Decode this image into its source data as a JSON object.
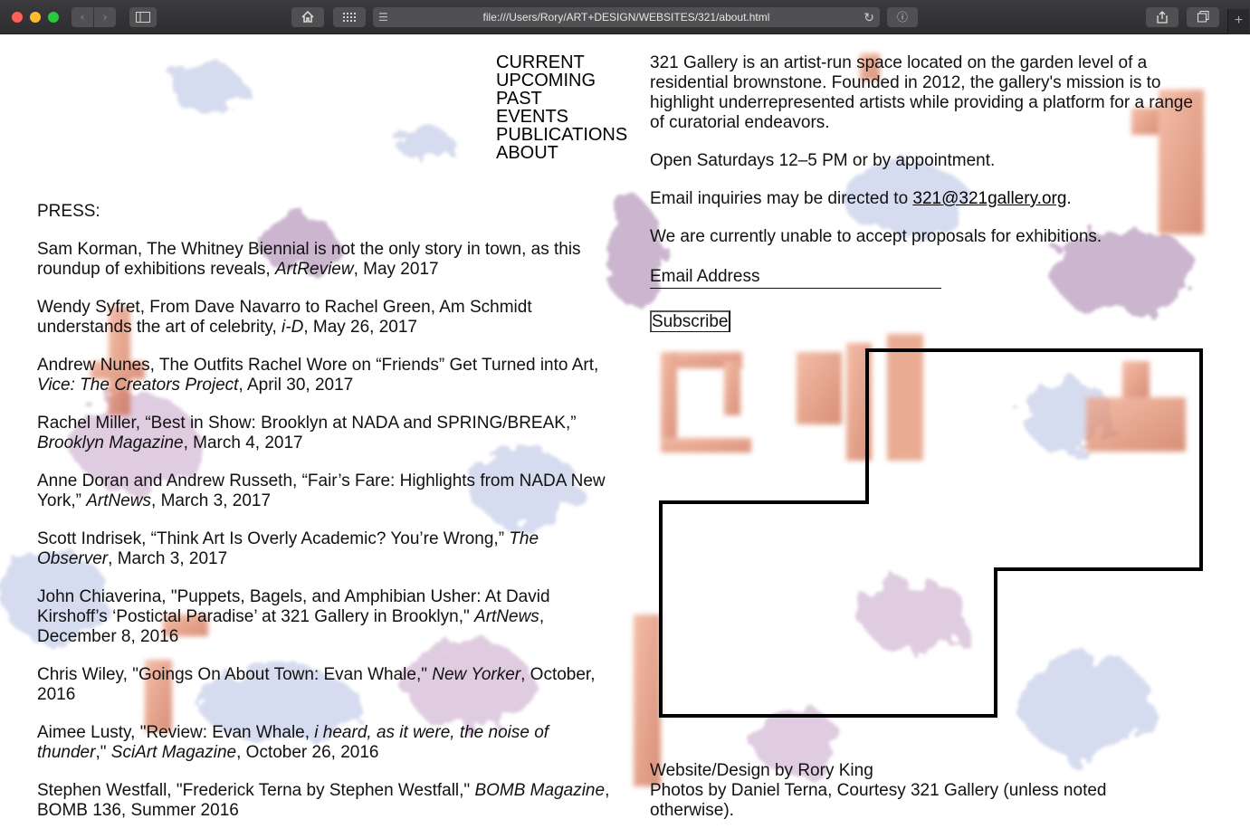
{
  "browser": {
    "url": "file:///Users/Rory/ART+DESIGN/WEBSITES/321/about.html"
  },
  "nav": {
    "items": [
      "CURRENT",
      "UPCOMING",
      "PAST",
      "EVENTS",
      "PUBLICATIONS",
      "ABOUT"
    ]
  },
  "press": {
    "heading": "PRESS:",
    "items": [
      {
        "pre": "Sam Korman, The Whitney Biennial is not the only story in town, as this roundup of exhibitions reveals, ",
        "pub": "ArtReview",
        "post": ", May 2017"
      },
      {
        "pre": "Wendy Syfret, From Dave Navarro to Rachel Green, Am Schmidt understands the art of celebrity, ",
        "pub": "i-D",
        "post": ", May 26, 2017"
      },
      {
        "pre": "Andrew Nunes, The Outfits Rachel Wore on “Friends” Get Turned into Art, ",
        "pub": "Vice: The Creators Project",
        "post": ", April 30, 2017"
      },
      {
        "pre": "Rachel Miller, “Best in Show: Brooklyn at NADA and SPRING/BREAK,” ",
        "pub": "Brooklyn Magazine",
        "post": ", March 4, 2017"
      },
      {
        "pre": "Anne Doran and Andrew Russeth, “Fair’s Fare: Highlights from NADA New York,” ",
        "pub": "ArtNews",
        "post": ", March 3, 2017"
      },
      {
        "pre": "Scott Indrisek, “Think Art Is Overly Academic? You’re Wrong,” ",
        "pub": "The Observer",
        "post": ", March 3, 2017"
      },
      {
        "pre": "John Chiaverina, \"Puppets, Bagels, and Amphibian Usher: At David Kirshoff’s ‘Postictal Paradise’ at 321 Gallery in Brooklyn,\" ",
        "pub": "ArtNews",
        "post": ", December 8, 2016"
      },
      {
        "pre": "Chris Wiley, \"Goings On About Town: Evan Whale,\" ",
        "pub": "New Yorker",
        "post": ", October, 2016"
      },
      {
        "pre": "Aimee Lusty, \"Review: Evan Whale, ",
        "pub": "i heard, as it were, the noise of thunder",
        "post": ",\" ",
        "pub2": "SciArt Magazine",
        "post2": ", October 26, 2016"
      },
      {
        "pre": "Stephen Westfall, \"Frederick Terna by Stephen Westfall,\" ",
        "pub": "BOMB Magazine",
        "post": ", BOMB 136, Summer 2016"
      }
    ]
  },
  "about": {
    "intro": "321 Gallery is an artist-run space located on the garden level of a residential brownstone. Founded in 2012, the gallery's mission is to highlight underrepresented artists while providing a platform for a range of curatorial endeavors.",
    "hours": "Open Saturdays 12–5 PM or by appointment.",
    "email_pre": "Email inquiries may be directed to ",
    "email": "321@321gallery.org",
    "email_post": ".",
    "proposals": "We are currently unable to accept proposals for exhibitions."
  },
  "newsletter": {
    "placeholder": "Email Address",
    "subscribe_label": "Subscribe"
  },
  "credits": {
    "line1": "Website/Design by Rory King",
    "line2": "Photos by Daniel Terna, Courtesy 321 Gallery (unless noted otherwise)."
  },
  "colors": {
    "accent_orange": "#e07a52",
    "lavender": "#a9b5dc",
    "mauve": "#a27aa8"
  }
}
